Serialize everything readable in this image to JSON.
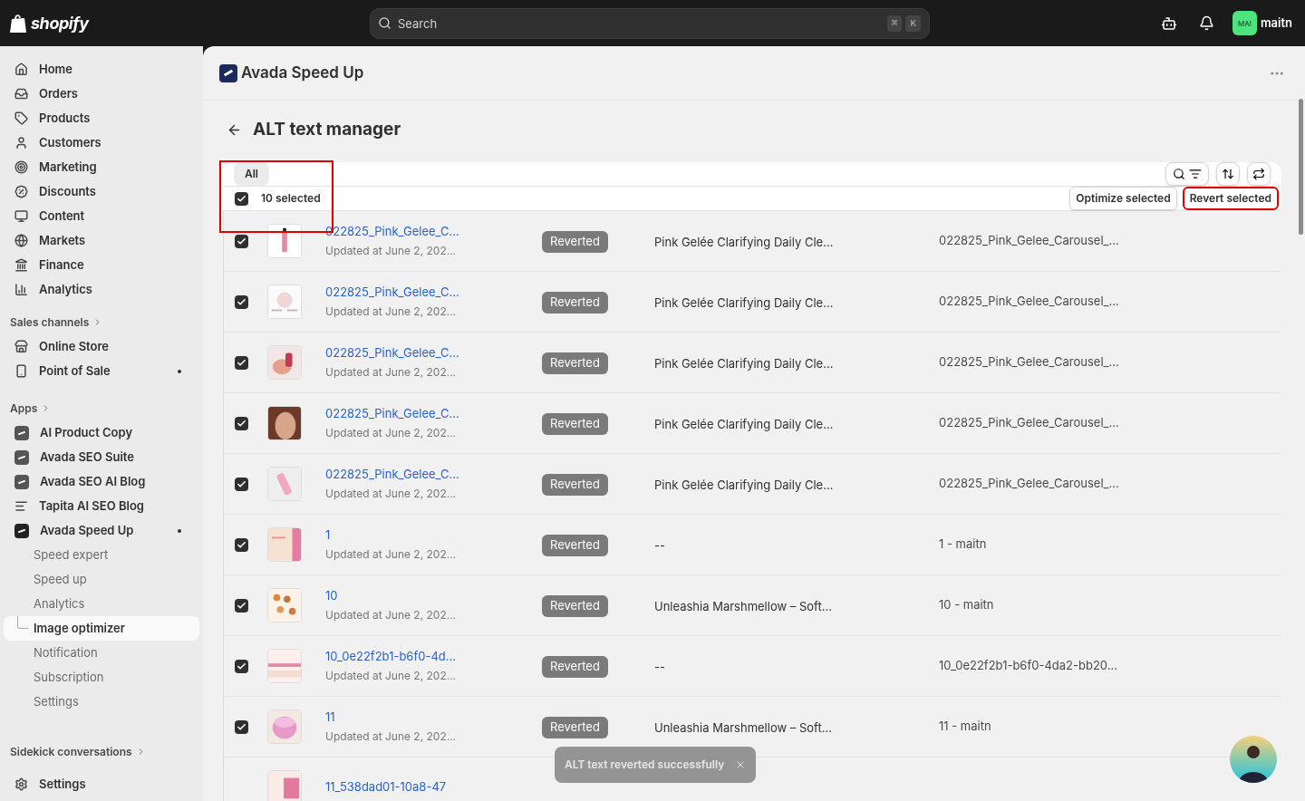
{
  "topbar": {
    "brand": "shopify",
    "search": {
      "placeholder": "Search",
      "keys": [
        "⌘",
        "K"
      ]
    },
    "avatar_initials": "MAI",
    "user": "maitn"
  },
  "sidebar": {
    "main": [
      {
        "label": "Home"
      },
      {
        "label": "Orders"
      },
      {
        "label": "Products"
      },
      {
        "label": "Customers"
      },
      {
        "label": "Marketing"
      },
      {
        "label": "Discounts"
      },
      {
        "label": "Content"
      },
      {
        "label": "Markets"
      },
      {
        "label": "Finance"
      },
      {
        "label": "Analytics"
      }
    ],
    "sales_channels": {
      "title": "Sales channels",
      "items": [
        {
          "label": "Online Store",
          "dot": false
        },
        {
          "label": "Point of Sale",
          "dot": true
        }
      ]
    },
    "apps": {
      "title": "Apps",
      "items": [
        {
          "label": "AI Product Copy",
          "dot": false
        },
        {
          "label": "Avada SEO Suite",
          "dot": false
        },
        {
          "label": "Avada SEO AI Blog",
          "dot": false
        },
        {
          "label": "Tapita AI SEO Blog",
          "dot": false
        },
        {
          "label": "Avada Speed Up",
          "dot": true,
          "children": [
            {
              "label": "Speed expert",
              "selected": false
            },
            {
              "label": "Speed up",
              "selected": false
            },
            {
              "label": "Analytics",
              "selected": false
            },
            {
              "label": "Image optimizer",
              "selected": true
            },
            {
              "label": "Notification",
              "selected": false
            },
            {
              "label": "Subscription",
              "selected": false
            },
            {
              "label": "Settings",
              "selected": false
            }
          ]
        }
      ]
    },
    "sidekick": "Sidekick conversations",
    "settings": "Settings"
  },
  "app_title": "Avada Speed Up",
  "page_title": "ALT text manager",
  "table": {
    "tabs": [
      {
        "label": "All",
        "selected": true
      }
    ],
    "filter_highlighted": true,
    "selection": {
      "checked": true,
      "label": "10 selected"
    },
    "actions": [
      {
        "label": "Optimize selected",
        "highlighted": false
      },
      {
        "label": "Revert selected",
        "highlighted": true
      }
    ],
    "rows": [
      {
        "name": "022825_Pink_Gelee_C...",
        "updated": "Updated at June 2, 202...",
        "status": "Reverted",
        "alt": "Pink Gelée Clarifying Daily Cle...",
        "file": "022825_Pink_Gelee_Carousel_...",
        "checked": true
      },
      {
        "name": "022825_Pink_Gelee_C...",
        "updated": "Updated at June 2, 202...",
        "status": "Reverted",
        "alt": "Pink Gelée Clarifying Daily Cle...",
        "file": "022825_Pink_Gelee_Carousel_...",
        "checked": true
      },
      {
        "name": "022825_Pink_Gelee_C...",
        "updated": "Updated at June 2, 202...",
        "status": "Reverted",
        "alt": "Pink Gelée Clarifying Daily Cle...",
        "file": "022825_Pink_Gelee_Carousel_...",
        "checked": true
      },
      {
        "name": "022825_Pink_Gelee_C...",
        "updated": "Updated at June 2, 202...",
        "status": "Reverted",
        "alt": "Pink Gelée Clarifying Daily Cle...",
        "file": "022825_Pink_Gelee_Carousel_...",
        "checked": true
      },
      {
        "name": "022825_Pink_Gelee_C...",
        "updated": "Updated at June 2, 202...",
        "status": "Reverted",
        "alt": "Pink Gelée Clarifying Daily Cle...",
        "file": "022825_Pink_Gelee_Carousel_...",
        "checked": true
      },
      {
        "name": "1",
        "updated": "Updated at June 2, 202...",
        "status": "Reverted",
        "alt": "--",
        "file": "1 - maitn",
        "checked": true
      },
      {
        "name": "10",
        "updated": "Updated at June 2, 202...",
        "status": "Reverted",
        "alt": "Unleashia Marshmellow – Soft...",
        "file": "10 - maitn",
        "checked": true
      },
      {
        "name": "10_0e22f2b1-b6f0-4d...",
        "updated": "Updated at June 2, 202...",
        "status": "Reverted",
        "alt": "--",
        "file": "10_0e22f2b1-b6f0-4da2-bb20...",
        "checked": true
      },
      {
        "name": "11",
        "updated": "Updated at June 2, 202...",
        "status": "Reverted",
        "alt": "Unleashia Marshmellow – Soft...",
        "file": "11 - maitn",
        "checked": true
      },
      {
        "name": "11_538dad01-10a8-47"
      }
    ]
  },
  "toast": "ALT text reverted successfully"
}
